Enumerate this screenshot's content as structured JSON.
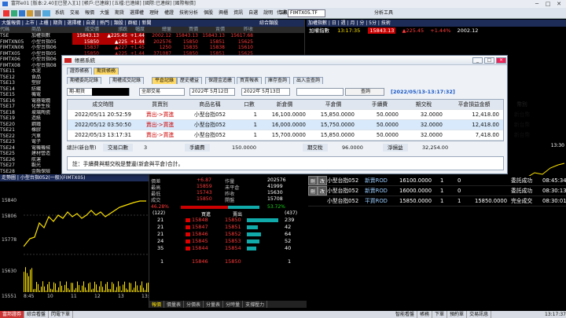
{
  "window": {
    "title": "富邦e01 [版本:2.40][已登入][1] [帳戶:已連線] [五檔:已連線] [國際:已連線] [國際報價]",
    "min": "─",
    "max": "□",
    "close": "✕"
  },
  "menubar": {
    "items": [
      "系統",
      "交易",
      "報價",
      "大盤",
      "期貨",
      "選擇權",
      "理財",
      "權證",
      "技術分析",
      "個股",
      "興櫃",
      "資訊",
      "自選",
      "說明",
      "工具"
    ],
    "code_label": "代碼",
    "ticker": "FIMTX05.TF",
    "analysis": "分析工具"
  },
  "quote_panel": {
    "title": "大盤報價 | 上市 | 上櫃 | 期貨 | 選擇權 | 自選 | 熱門 | 類股 | 群組 | 新聞",
    "sector_label": "綜合類股",
    "headers": [
      "代碼",
      "商品",
      "成交價",
      "漲跌",
      "幅度",
      "總量",
      "買價",
      "賣價",
      "昨收"
    ],
    "rows": [
      {
        "code": "TSE",
        "name": "加權指數",
        "price": "15843.13",
        "chg": "▲225.45",
        "pct": "+1.44",
        "vol": "2002.12",
        "bid": "15843.13",
        "ask": "15843.13",
        "prev": "15617.68",
        "color": "red",
        "hl": true
      },
      {
        "code": "FIMTXN05",
        "name": "小型台指05",
        "price": "15850",
        "chg": "▲225",
        "pct": "+1.44",
        "vol": "202576",
        "bid": "15850",
        "ask": "15851",
        "prev": "15625",
        "color": "red",
        "hl": true
      },
      {
        "code": "FIMTXN06",
        "name": "小型台指06",
        "price": "15837",
        "chg": "▲227",
        "pct": "+1.45",
        "vol": "1250",
        "bid": "15835",
        "ask": "15838",
        "prev": "15610",
        "color": "red",
        "hl": false
      },
      {
        "code": "FIMTX05",
        "name": "小型台指05",
        "price": "15850",
        "chg": "▲225",
        "pct": "+1.44",
        "vol": "371087",
        "bid": "15850",
        "ask": "15851",
        "prev": "15625",
        "color": "red",
        "hl": false
      },
      {
        "code": "FIMTX06",
        "name": "小型台指06",
        "price": "15831",
        "chg": "▲222",
        "pct": "+1.42",
        "vol": "2081",
        "bid": "15830",
        "ask": "15832",
        "prev": "15609",
        "color": "red",
        "hl": false
      },
      {
        "code": "FIMTX08",
        "name": "小型台指08",
        "price": "15806",
        "chg": "▲216",
        "pct": "+1.39",
        "vol": "55",
        "bid": "15806",
        "ask": "15812",
        "prev": "15590",
        "color": "red",
        "hl": false
      },
      {
        "code": "TSE11",
        "name": "水泥",
        "price": "",
        "chg": "",
        "pct": "",
        "vol": "",
        "bid": "",
        "ask": "",
        "prev": "",
        "color": "white",
        "hl": false
      },
      {
        "code": "TSE12",
        "name": "食品",
        "price": "",
        "chg": "",
        "pct": "",
        "vol": "",
        "bid": "",
        "ask": "",
        "prev": "",
        "color": "white",
        "hl": false
      },
      {
        "code": "TSE13",
        "name": "塑膠",
        "price": "",
        "chg": "",
        "pct": "",
        "vol": "",
        "bid": "",
        "ask": "",
        "prev": "",
        "color": "white",
        "hl": false
      },
      {
        "code": "TSE14",
        "name": "紡織",
        "price": "",
        "chg": "",
        "pct": "",
        "vol": "",
        "bid": "",
        "ask": "",
        "prev": "",
        "color": "white",
        "hl": false
      },
      {
        "code": "TSE15",
        "name": "機電",
        "price": "",
        "chg": "",
        "pct": "",
        "vol": "",
        "bid": "",
        "ask": "",
        "prev": "",
        "color": "white",
        "hl": false
      },
      {
        "code": "TSE16",
        "name": "電器電纜",
        "price": "",
        "chg": "",
        "pct": "",
        "vol": "",
        "bid": "",
        "ask": "",
        "prev": "",
        "color": "white",
        "hl": false
      },
      {
        "code": "TSE17",
        "name": "化學生技",
        "price": "",
        "chg": "",
        "pct": "",
        "vol": "",
        "bid": "",
        "ask": "",
        "prev": "",
        "color": "white",
        "hl": false
      },
      {
        "code": "TSE18",
        "name": "玻璃陶瓷",
        "price": "",
        "chg": "",
        "pct": "",
        "vol": "",
        "bid": "",
        "ask": "",
        "prev": "",
        "color": "white",
        "hl": false
      },
      {
        "code": "TSE19",
        "name": "造紙",
        "price": "",
        "chg": "",
        "pct": "",
        "vol": "",
        "bid": "",
        "ask": "",
        "prev": "",
        "color": "white",
        "hl": false
      },
      {
        "code": "TSE20",
        "name": "鋼鐵",
        "price": "",
        "chg": "",
        "pct": "",
        "vol": "",
        "bid": "",
        "ask": "",
        "prev": "",
        "color": "white",
        "hl": false
      },
      {
        "code": "TSE21",
        "name": "橡膠",
        "price": "",
        "chg": "",
        "pct": "",
        "vol": "",
        "bid": "",
        "ask": "",
        "prev": "",
        "color": "white",
        "hl": false
      },
      {
        "code": "TSE22",
        "name": "汽車",
        "price": "",
        "chg": "",
        "pct": "",
        "vol": "",
        "bid": "",
        "ask": "",
        "prev": "",
        "color": "white",
        "hl": false
      },
      {
        "code": "TSE23",
        "name": "電子",
        "price": "",
        "chg": "",
        "pct": "",
        "vol": "",
        "bid": "",
        "ask": "",
        "prev": "",
        "color": "white",
        "hl": false
      },
      {
        "code": "TSE24",
        "name": "電機機械",
        "price": "",
        "chg": "",
        "pct": "",
        "vol": "",
        "bid": "",
        "ask": "",
        "prev": "",
        "color": "white",
        "hl": false
      },
      {
        "code": "TSE25",
        "name": "建材營造",
        "price": "",
        "chg": "",
        "pct": "",
        "vol": "",
        "bid": "",
        "ask": "",
        "prev": "",
        "color": "white",
        "hl": false
      },
      {
        "code": "TSE26",
        "name": "航運",
        "price": "",
        "chg": "",
        "pct": "",
        "vol": "",
        "bid": "",
        "ask": "",
        "prev": "",
        "color": "white",
        "hl": false
      },
      {
        "code": "TSE27",
        "name": "觀光",
        "price": "",
        "chg": "",
        "pct": "",
        "vol": "",
        "bid": "",
        "ask": "",
        "prev": "",
        "color": "white",
        "hl": false
      },
      {
        "code": "TSE28",
        "name": "金融保險",
        "price": "",
        "chg": "",
        "pct": "",
        "vol": "",
        "bid": "",
        "ask": "",
        "prev": "",
        "color": "white",
        "hl": false
      }
    ]
  },
  "index_panel": {
    "title": "加權指數 | 日 | 週 | 月 | 分 | 5分 | 技術",
    "name": "加權指數",
    "time": "13:17:35",
    "value": "15843.13",
    "chg": "▲225.45",
    "pct": "+1.44%",
    "vol": "2002.12"
  },
  "right_chart": {
    "title": "加權指數走勢",
    "time_label": "13:30",
    "top_val": "15630",
    "bot_val": "15560"
  },
  "dialog": {
    "title": "帳務系統",
    "top_tabs": [
      "證券帳務",
      "期貨帳務"
    ],
    "sub_tabs": [
      "期權委託記錄",
      "期權成交記錄",
      "平倉記錄",
      "歷史權益",
      "保證金追繳",
      "買賣報表",
      "庫存查詢",
      "出入金查詢"
    ],
    "account": "期-期貨",
    "account_masked": "",
    "filter": "全部交易",
    "date_from": "2022年 5月12日",
    "date_to": "2022年 5月13日",
    "query_btn": "查詢",
    "updated": "[2022/05/13-13:17:32]",
    "columns": [
      "成交時間",
      "買賣別",
      "商品名稱",
      "口數",
      "新倉價",
      "平倉價",
      "手續費",
      "期交稅",
      "平倉損益金額",
      "幣別"
    ],
    "rows": [
      {
        "time": "2022/05/11 20:52:59",
        "side": "賣出->買進",
        "product": "小型台指052",
        "qty": "1",
        "open": "16,100.0000",
        "close": "15,850.0000",
        "fee": "50.0000",
        "tax": "32.0000",
        "pnl": "12,418.00",
        "ccy": "新台幣"
      },
      {
        "time": "2022/05/12 03:50:50",
        "side": "賣出->買進",
        "product": "小型台指052",
        "qty": "1",
        "open": "16,000.0000",
        "close": "15,750.0000",
        "fee": "50.0000",
        "tax": "32.0000",
        "pnl": "12,418.00",
        "ccy": "新台幣"
      },
      {
        "time": "2022/05/13 13:17:31",
        "side": "賣出->買進",
        "product": "小型台指052",
        "qty": "1",
        "open": "15,700.0000",
        "close": "15,850.0000",
        "fee": "50.0000",
        "tax": "32.0000",
        "pnl": "7,418.00",
        "ccy": "新台幣"
      }
    ],
    "summary": {
      "label": "總計(新台幣)",
      "qty_label": "交易口數",
      "qty": "3",
      "fee_label": "手續費",
      "fee": "150.0000",
      "tax_label": "期交稅",
      "tax": "96.0000",
      "pnl_label": "淨損益",
      "pnl": "32,254.00"
    },
    "note": "註：手續費與期交稅是雙邊(新倉與平倉)合計。"
  },
  "chart_panel": {
    "title": "走勢圖 | 小型台指052(一般)(FIMTX05)",
    "y_labels": [
      "15840",
      "15806",
      "15778",
      "15630",
      "15551"
    ],
    "x_labels": [
      "8:45",
      "10",
      "11",
      "12",
      "13",
      "13:45"
    ],
    "bottom_tabs": [
      "報價",
      "價量表",
      "分價表",
      "分量表",
      "分時量",
      "支撐壓力"
    ]
  },
  "detail_panel": {
    "rows": [
      {
        "l": "價差",
        "v": "+6.87",
        "l2": "作量",
        "v2": "202576"
      },
      {
        "l": "最高",
        "v": "15859",
        "l2": "未平倉",
        "v2": "41999"
      },
      {
        "l": "最低",
        "v": "15743",
        "l2": "昨收",
        "v2": "15630"
      },
      {
        "l": "成交",
        "v": "15850",
        "l2": "開盤",
        "v2": "15708"
      }
    ],
    "ratio_l": "46.28%",
    "ratio_r": "53.72%",
    "ob_left": "(122)",
    "ob_right": "(437)",
    "ob_buy": "買進",
    "ob_sell": "賣出",
    "book": [
      {
        "bq": "21",
        "bid": "15848",
        "ask": "15850",
        "aq": "239"
      },
      {
        "bq": "21",
        "bid": "15847",
        "ask": "15851",
        "aq": "42"
      },
      {
        "bq": "21",
        "bid": "15846",
        "ask": "15852",
        "aq": "64"
      },
      {
        "bq": "24",
        "bid": "15845",
        "ask": "15853",
        "aq": "52"
      },
      {
        "bq": "35",
        "bid": "15844",
        "ask": "15854",
        "aq": "40"
      }
    ],
    "bottom": {
      "l": "1",
      "bid": "15846",
      "ask": "15850",
      "r": "1"
    }
  },
  "order_panel": {
    "rows": [
      {
        "a": "刪",
        "b": "改",
        "product": "小型台指052",
        "type": "新賣ROD",
        "price": "16100.0000",
        "qty": "1",
        "filled": "0",
        "avg": "",
        "status": "委託成功",
        "time": "08:45:34"
      },
      {
        "a": "刪",
        "b": "改",
        "product": "小型台指052",
        "type": "新賣ROD",
        "price": "16000.0000",
        "qty": "1",
        "filled": "0",
        "avg": "",
        "status": "委託成功",
        "time": "08:30:13"
      },
      {
        "a": "",
        "b": "",
        "product": "小型台指052",
        "type": "平買ROD",
        "price": "15850.0000",
        "qty": "1",
        "filled": "1",
        "avg": "15850.0000",
        "status": "完全成交",
        "time": "08:30:01"
      }
    ]
  },
  "statusbar": {
    "left": [
      "富邦證券",
      "綜合看盤",
      "閃電下單"
    ],
    "right": [
      "智能看盤",
      "帳務",
      "下單",
      "預約單",
      "交易訊息"
    ],
    "time": "13:17:37"
  }
}
